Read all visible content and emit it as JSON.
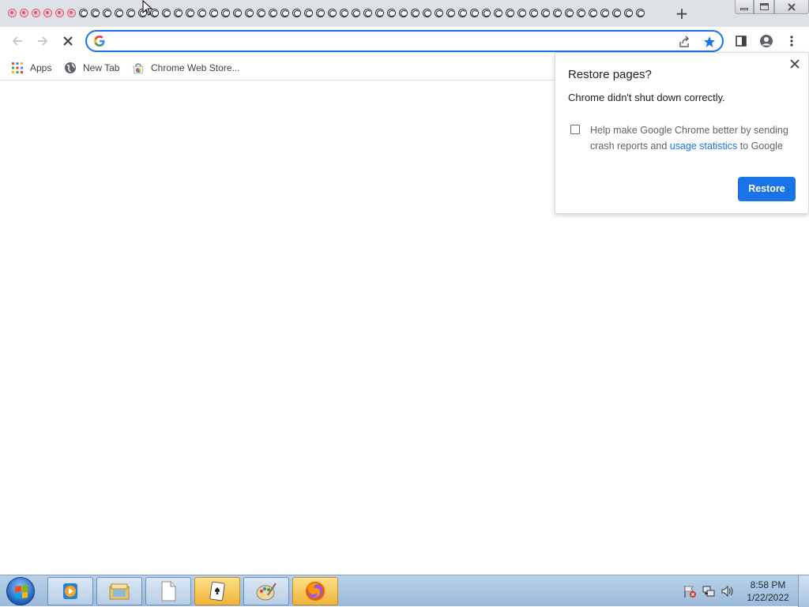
{
  "window": {
    "tabs_count_dead": 6,
    "tabs_count_loading": 48,
    "new_tab_glyph": "+"
  },
  "toolbar": {
    "omnibox_value": "",
    "icons": [
      "back-icon",
      "forward-icon",
      "stop-icon",
      "google-icon",
      "share-icon",
      "bookmark-star-icon",
      "side-panel-icon",
      "profile-icon",
      "menu-icon"
    ]
  },
  "bookmarks": {
    "items": [
      {
        "label": "Apps",
        "icon": "apps-grid-icon"
      },
      {
        "label": "New Tab",
        "icon": "globe-icon"
      },
      {
        "label": "Chrome Web Store...",
        "icon": "web-store-icon"
      }
    ]
  },
  "restore_bubble": {
    "title": "Restore pages?",
    "message": "Chrome didn't shut down correctly.",
    "checkbox_text_before": "Help make Google Chrome better by sending crash reports and ",
    "checkbox_link": "usage statistics",
    "checkbox_text_after": " to Google",
    "checkbox_checked": false,
    "restore_label": "Restore",
    "close_glyph": "✕"
  },
  "taskbar": {
    "clock_time": "8:58 PM",
    "clock_date": "1/22/2022",
    "apps": [
      "media-player-icon",
      "file-explorer-icon",
      "document-icon",
      "solitaire-icon",
      "paint-icon",
      "firefox-icon"
    ],
    "active_apps": [
      "solitaire-icon",
      "firefox-icon"
    ]
  },
  "colors": {
    "accent": "#1a73e8",
    "tabstrip": "#dee1e6",
    "taskbar": "#b9d1ea"
  }
}
